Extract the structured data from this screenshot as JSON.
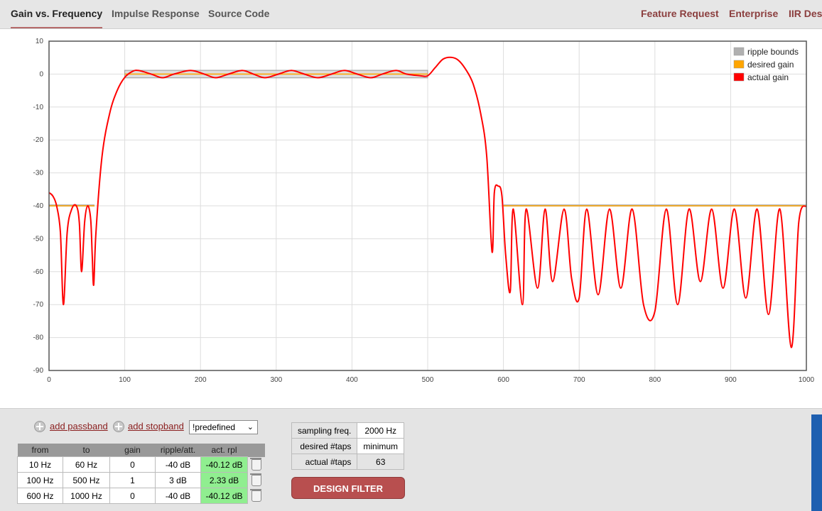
{
  "tabs": [
    {
      "label": "Gain vs. Frequency",
      "active": true
    },
    {
      "label": "Impulse Response",
      "active": false
    },
    {
      "label": "Source Code",
      "active": false
    }
  ],
  "right_links": [
    "Feature Request",
    "Enterprise",
    "IIR Desi"
  ],
  "chart_data": {
    "type": "line",
    "x_ticks": [
      "0",
      "100",
      "200",
      "300",
      "400",
      "500",
      "600",
      "700",
      "800",
      "900",
      "1000"
    ],
    "y_ticks": [
      "10",
      "0",
      "-10",
      "-20",
      "-30",
      "-40",
      "-50",
      "-60",
      "-70",
      "-80",
      "-90"
    ],
    "xlim": [
      0,
      1000
    ],
    "ylim": [
      -90,
      10
    ],
    "grid": true,
    "legend_position": "top-right",
    "legend": [
      {
        "label": "ripple bounds",
        "color": "#b0b0b0"
      },
      {
        "label": "desired gain",
        "color": "#ffa500"
      },
      {
        "label": "actual gain",
        "color": "#ff0000"
      }
    ],
    "ripple_bounds": [
      {
        "from": 0,
        "to": 60,
        "upper": -40
      },
      {
        "from": 100,
        "to": 500,
        "upper": 1.15,
        "lower": -1.15
      },
      {
        "from": 600,
        "to": 1000,
        "upper": -40
      }
    ],
    "desired_gain": [
      {
        "from": 0,
        "to": 60,
        "value": -40
      },
      {
        "from": 100,
        "to": 500,
        "value": 0
      },
      {
        "from": 600,
        "to": 1000,
        "value": -40
      }
    ],
    "series": [
      {
        "name": "actual gain",
        "x": [
          0,
          5,
          10,
          15,
          19,
          24,
          30,
          36,
          40,
          43,
          47,
          51,
          55,
          57,
          59,
          62,
          70,
          80,
          90,
          100,
          110,
          118,
          135,
          150,
          165,
          187,
          205,
          220,
          237,
          255,
          270,
          285,
          303,
          320,
          337,
          355,
          373,
          390,
          407,
          425,
          440,
          458,
          472,
          490,
          500,
          510,
          520,
          530,
          540,
          550,
          560,
          570,
          578,
          585,
          588,
          593,
          598,
          603,
          609,
          613,
          625,
          630,
          645,
          655,
          665,
          680,
          690,
          700,
          710,
          725,
          740,
          755,
          770,
          785,
          800,
          815,
          830,
          845,
          860,
          875,
          890,
          905,
          920,
          935,
          950,
          965,
          980,
          990,
          1000
        ],
        "y": [
          -36,
          -37,
          -40,
          -48,
          -70,
          -48,
          -41,
          -40,
          -45,
          -60,
          -45,
          -40,
          -44,
          -55,
          -64,
          -48,
          -25,
          -12,
          -5,
          -1,
          0.8,
          1.1,
          0,
          -1.1,
          0,
          1.1,
          0,
          -1.1,
          0,
          1.1,
          0,
          -1.1,
          0,
          1.1,
          0,
          -1.1,
          0,
          1.1,
          0,
          -1.1,
          0,
          1.1,
          0,
          -0.5,
          -0.5,
          2,
          4.5,
          5.1,
          4.3,
          1.5,
          -3,
          -12,
          -25,
          -54,
          -36,
          -34,
          -37,
          -55,
          -66,
          -41,
          -70,
          -41,
          -65,
          -41,
          -63,
          -41,
          -62,
          -68,
          -41,
          -67,
          -41,
          -65,
          -41,
          -70,
          -72,
          -41,
          -70,
          -41,
          -63,
          -41,
          -65,
          -41,
          -68,
          -41,
          -73,
          -41,
          -83,
          -45,
          -40
        ]
      }
    ]
  },
  "controls": {
    "add_passband": "add passband",
    "add_stopband": "add stopband",
    "predefined": "!predefined"
  },
  "bands_table": {
    "headers": [
      "from",
      "to",
      "gain",
      "ripple/att.",
      "act. rpl"
    ],
    "rows": [
      {
        "from": "10 Hz",
        "to": "60 Hz",
        "gain": "0",
        "ripple": "-40 dB",
        "act": "-40.12 dB"
      },
      {
        "from": "100 Hz",
        "to": "500 Hz",
        "gain": "1",
        "ripple": "3 dB",
        "act": "2.33 dB"
      },
      {
        "from": "600 Hz",
        "to": "1000 Hz",
        "gain": "0",
        "ripple": "-40 dB",
        "act": "-40.12 dB"
      }
    ]
  },
  "params": {
    "sampling_label": "sampling freq.",
    "sampling_value": "2000 Hz",
    "desired_taps_label": "desired #taps",
    "desired_taps_value": "minimum",
    "actual_taps_label": "actual #taps",
    "actual_taps_value": "63"
  },
  "design_button": "DESIGN FILTER"
}
